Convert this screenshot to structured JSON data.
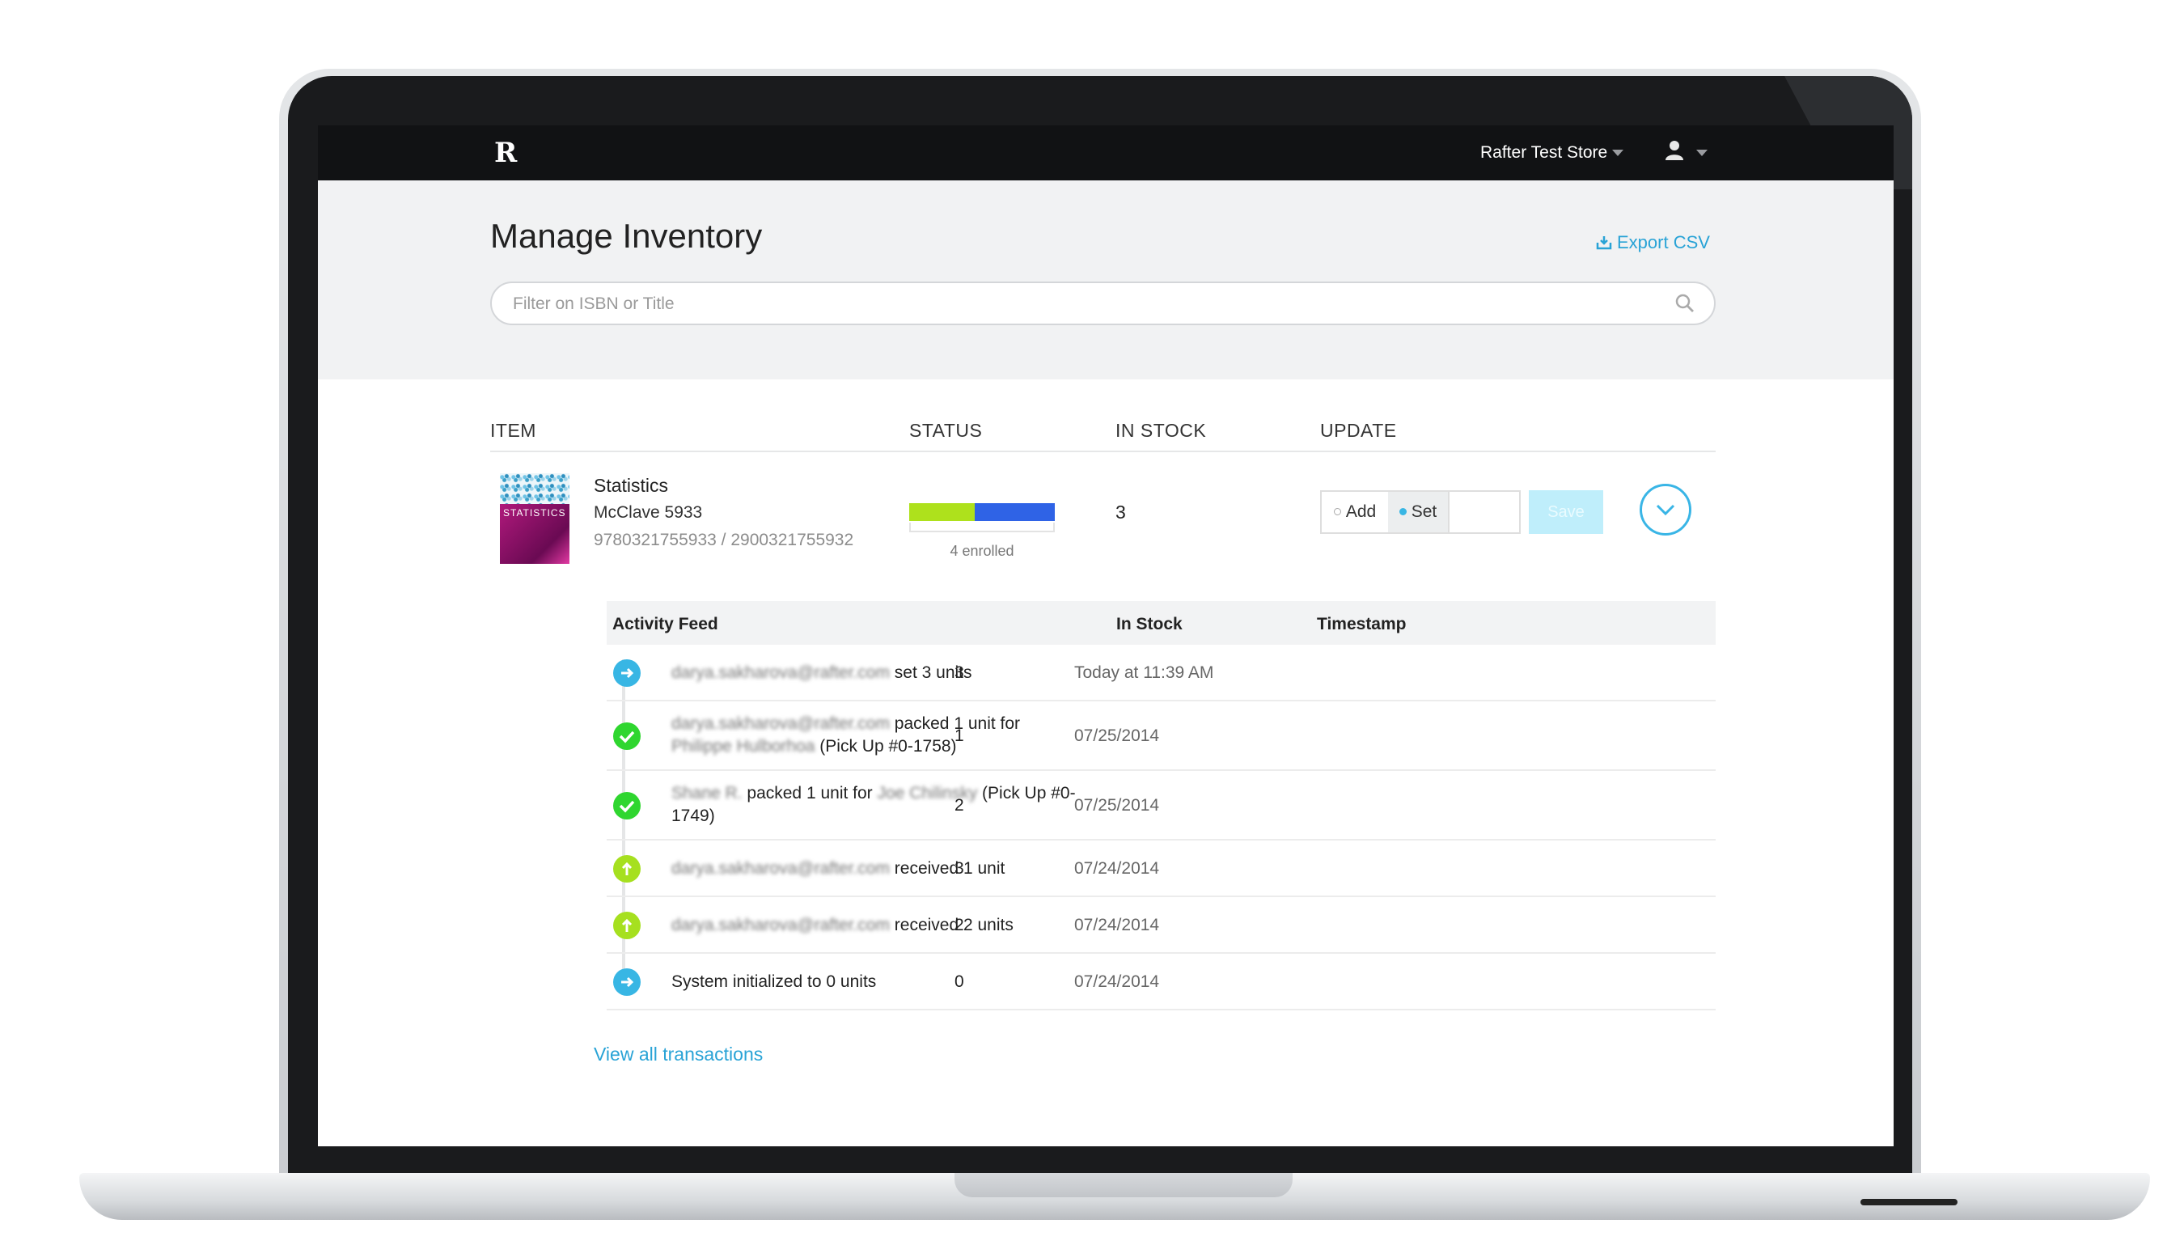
{
  "nav": {
    "logo": "R",
    "store_name": "Rafter Test Store"
  },
  "header": {
    "title": "Manage Inventory",
    "export_label": "Export CSV",
    "search_placeholder": "Filter on ISBN or Title"
  },
  "columns": {
    "item": "ITEM",
    "status": "STATUS",
    "in_stock": "IN STOCK",
    "update": "UPDATE"
  },
  "item": {
    "title": "Statistics",
    "author": "McClave 5933",
    "isbns": "9780321755933 / 2900321755932",
    "cover_text": "STATISTICS",
    "status": {
      "green_fraction": 0.45,
      "blue_fraction": 0.55,
      "enrolled": "4 enrolled"
    },
    "in_stock": "3",
    "update": {
      "add_label": "Add",
      "set_label": "Set",
      "selected": "Set",
      "save_label": "Save",
      "quantity": ""
    }
  },
  "colors": {
    "accent": "#29a3d6",
    "green": "#aee11c",
    "blue": "#2f63e6",
    "check": "#2fd62f",
    "arrow": "#38b6e4"
  },
  "feed": {
    "headers": {
      "activity": "Activity Feed",
      "stock": "In Stock",
      "timestamp": "Timestamp"
    },
    "rows": [
      {
        "icon": "arrow-right-icon",
        "user": "darya.sakharova@rafter.com",
        "text": " set 3 units",
        "stock": "3",
        "time": "Today at 11:39 AM"
      },
      {
        "icon": "check-icon",
        "user": "darya.sakharova@rafter.com",
        "text": " packed 1 unit for",
        "user2": "Philippe Hulborhoa",
        "text2": " (Pick Up #0-1758)",
        "stock": "1",
        "time": "07/25/2014"
      },
      {
        "icon": "check-icon",
        "user": "Shane R.",
        "text": " packed 1 unit for ",
        "user2": "Joe Chilinsky",
        "text2": " (Pick Up #0-1749)",
        "stock": "2",
        "time": "07/25/2014"
      },
      {
        "icon": "arrow-up-icon",
        "user": "darya.sakharova@rafter.com",
        "text": " received 1 unit",
        "stock": "3",
        "time": "07/24/2014"
      },
      {
        "icon": "arrow-up-icon",
        "user": "darya.sakharova@rafter.com",
        "text": " received 2 units",
        "stock": "2",
        "time": "07/24/2014"
      },
      {
        "icon": "arrow-right-icon",
        "user": "",
        "text": "System initialized to 0 units",
        "stock": "0",
        "time": "07/24/2014"
      }
    ],
    "view_all": "View all transactions"
  }
}
